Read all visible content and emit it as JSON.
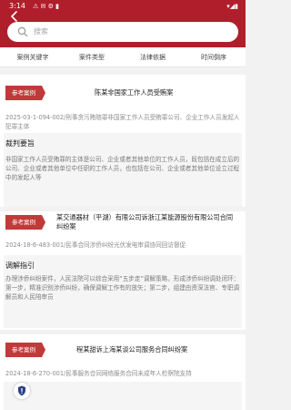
{
  "status_bar": {
    "time": "3:14",
    "icons": "⚠ ✉ ⚙ ▮",
    "right": "▾◢▮"
  },
  "search": {
    "placeholder": "搜索"
  },
  "filters": [
    "案例关键字",
    "案件类型",
    "法律依据",
    "时间倒序"
  ],
  "cards": [
    {
      "tag": "参考案例",
      "title": "陈某非国家工作人员受贿案",
      "meta": "2025-03-1-094-002/刑事贪污贿赂罪非国家工作人员受贿罪公司、企业工作人员发起人犯罪主体",
      "section_title": "裁判要旨",
      "section_body": "非国家工作人员受贿罪的主体是公司、企业或者其他单位的工作人员，既包括在成立后的公司、企业或者其他单位中任职的工作人员，也包括在公司、企业或者其他单位设立过程中的发起人等"
    },
    {
      "tag": "参考案例",
      "title": "某交通器材（平湖）有限公司诉浙江某能源股份有限公司合同纠纷案",
      "meta": "2024-18-6-483-001/民事合同涉侨纠纷光伏发电审调协同回访督促",
      "section_title": "调解指引",
      "section_body": "办理涉侨纠纷案件，人民法院可以综合采用“五步走”调解策略，形成涉侨纠纷调处闭环：第一步，精准识别涉侨纠纷，确保调解工作有的放矢；第二步，组建由资深法官、专职调解员和人民陪审员"
    },
    {
      "tag": "参考案例",
      "title": "程某甜诉上海某谈公司服务合同纠纷案",
      "meta": "2024-18-6-270-001/民事服务合同网络服务合同未成年人检察院支持"
    }
  ]
}
